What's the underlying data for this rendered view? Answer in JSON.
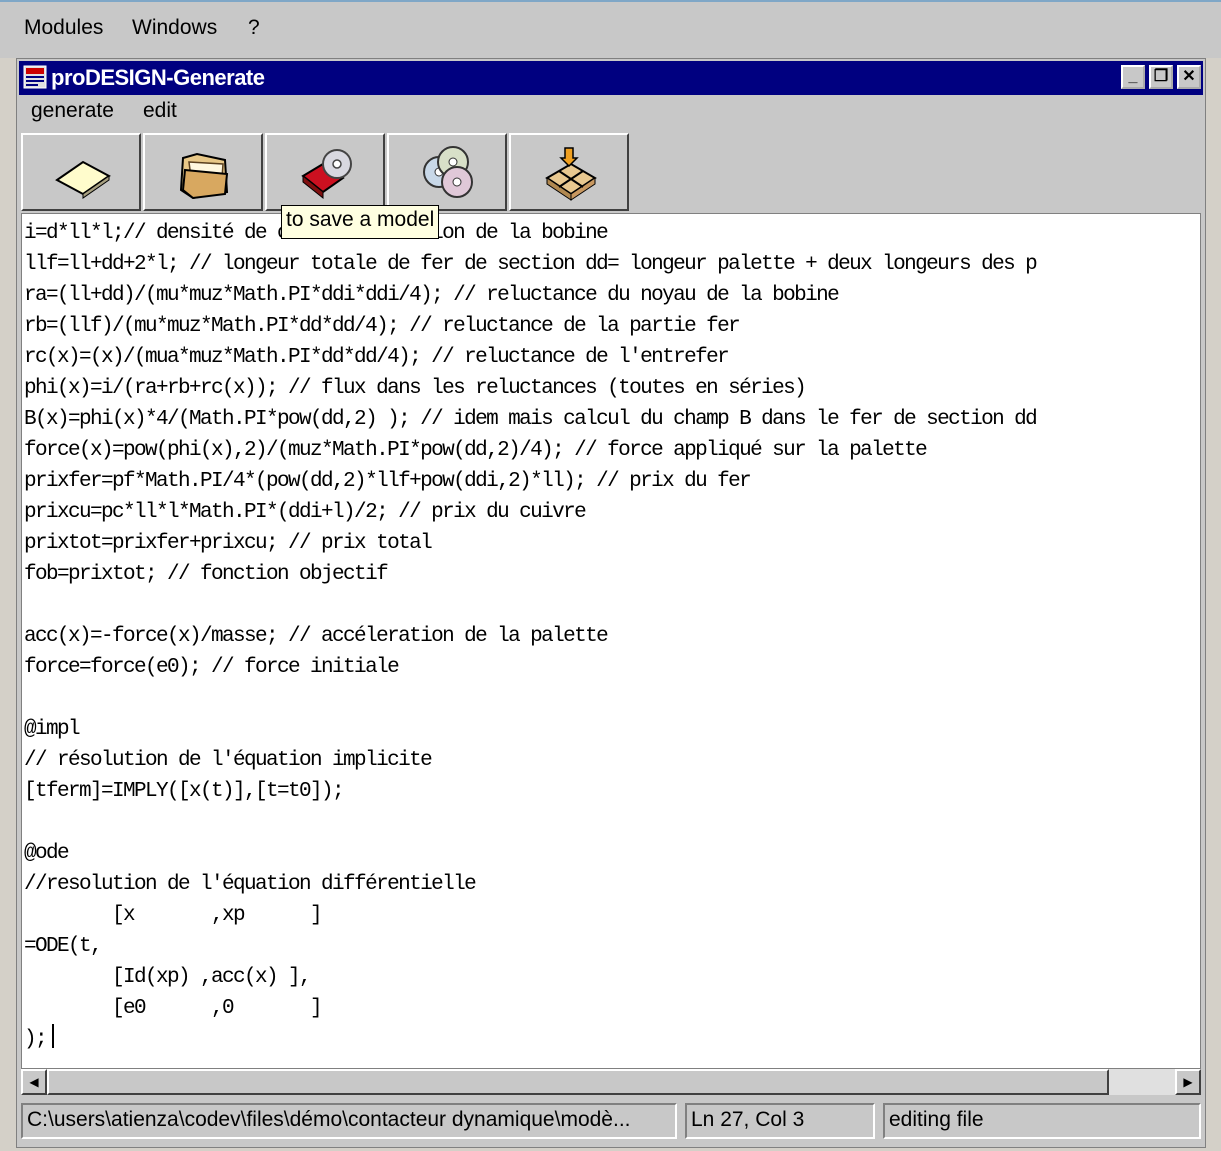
{
  "outer_menu": [
    "Modules",
    "Windows",
    "?"
  ],
  "window": {
    "title": "proDESIGN-Generate",
    "controls": {
      "minimize": "_",
      "restore": "❐",
      "close": "✕"
    }
  },
  "inner_menu": [
    "generate",
    "edit"
  ],
  "toolbar": {
    "buttons": [
      {
        "icon": "new-document-icon"
      },
      {
        "icon": "open-folder-icon"
      },
      {
        "icon": "save-book-cd-icon"
      },
      {
        "icon": "cd-discs-icon"
      },
      {
        "icon": "package-icon"
      }
    ],
    "tooltip": "to save a model"
  },
  "editor": {
    "code": "i=d*ll*l;// densité de courant * section de la bobine\nllf=ll+dd+2*l; // longeur totale de fer de section dd= longeur palette + deux longeurs des p\nra=(ll+dd)/(mu*muz*Math.PI*ddi*ddi/4); // reluctance du noyau de la bobine\nrb=(llf)/(mu*muz*Math.PI*dd*dd/4); // reluctance de la partie fer\nrc(x)=(x)/(mua*muz*Math.PI*dd*dd/4); // reluctance de l'entrefer\nphi(x)=i/(ra+rb+rc(x)); // flux dans les reluctances (toutes en séries)\nB(x)=phi(x)*4/(Math.PI*pow(dd,2) ); // idem mais calcul du champ B dans le fer de section dd\nforce(x)=pow(phi(x),2)/(muz*Math.PI*pow(dd,2)/4); // force appliqué sur la palette\nprixfer=pf*Math.PI/4*(pow(dd,2)*llf+pow(ddi,2)*ll); // prix du fer\nprixcu=pc*ll*l*Math.PI*(ddi+l)/2; // prix du cuivre\nprixtot=prixfer+prixcu; // prix total\nfob=prixtot; // fonction objectif\n\nacc(x)=-force(x)/masse; // accéleration de la palette\nforce=force(e0); // force initiale\n\n@impl\n// résolution de l'équation implicite\n[tferm]=IMPLY([x(t)],[t=t0]);\n\n@ode\n//resolution de l'équation différentielle\n        [x       ,xp      ]\n=ODE(t,\n        [Id(xp) ,acc(x) ],\n        [e0      ,0       ]\n);"
  },
  "status": {
    "path": "C:\\users\\atienza\\codev\\files\\démo\\contacteur dynamique\\modè...",
    "position": "Ln 27, Col 3",
    "mode": "editing file"
  },
  "colors": {
    "titlebar": "#000080",
    "tooltip_bg": "#ffffe1",
    "chrome": "#c8c8c8"
  }
}
